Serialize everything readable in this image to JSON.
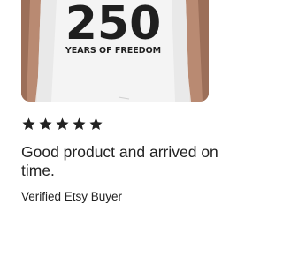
{
  "review": {
    "photo": {
      "shirt_number": "250",
      "shirt_caption": "YEARS OF FREEDOM"
    },
    "rating": {
      "value": 5,
      "max": 5,
      "star_color": "#222222"
    },
    "text": "Good product and arrived on time.",
    "reviewer": "Verified Etsy Buyer"
  }
}
